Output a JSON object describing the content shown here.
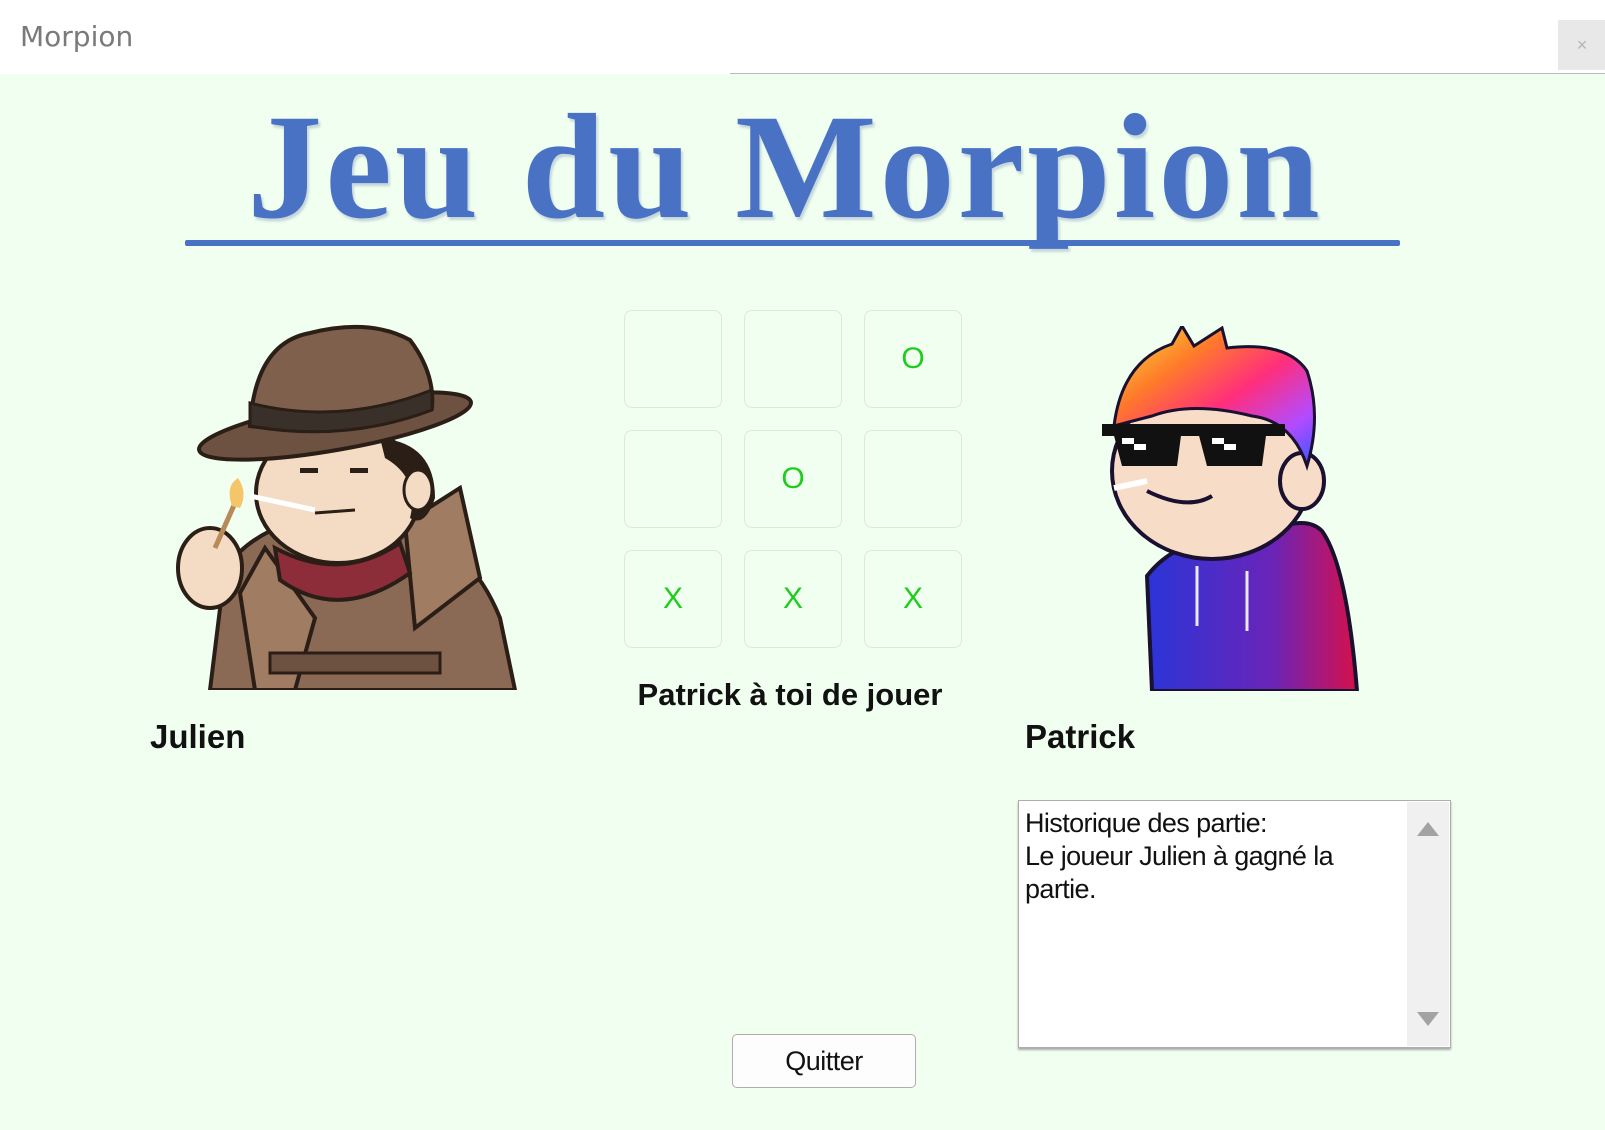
{
  "window": {
    "title": "Morpion",
    "close_label": "×"
  },
  "banner": {
    "title": "Jeu du Morpion"
  },
  "players": [
    {
      "name": "Julien",
      "avatar_icon": "detective-avatar-icon"
    },
    {
      "name": "Patrick",
      "avatar_icon": "rainbow-hair-sunglasses-avatar-icon"
    }
  ],
  "board": {
    "cells": [
      "",
      "",
      "O",
      "",
      "O",
      "",
      "X",
      "X",
      "X"
    ]
  },
  "status": "Patrick à toi de jouer",
  "history": {
    "text": "Historique des partie:\nLe joueur Julien à gagné la\npartie."
  },
  "buttons": {
    "quit": "Quitter"
  },
  "colors": {
    "background": "#f0fff0",
    "banner": "#4a72c4",
    "mark": "#1fcc1f"
  }
}
